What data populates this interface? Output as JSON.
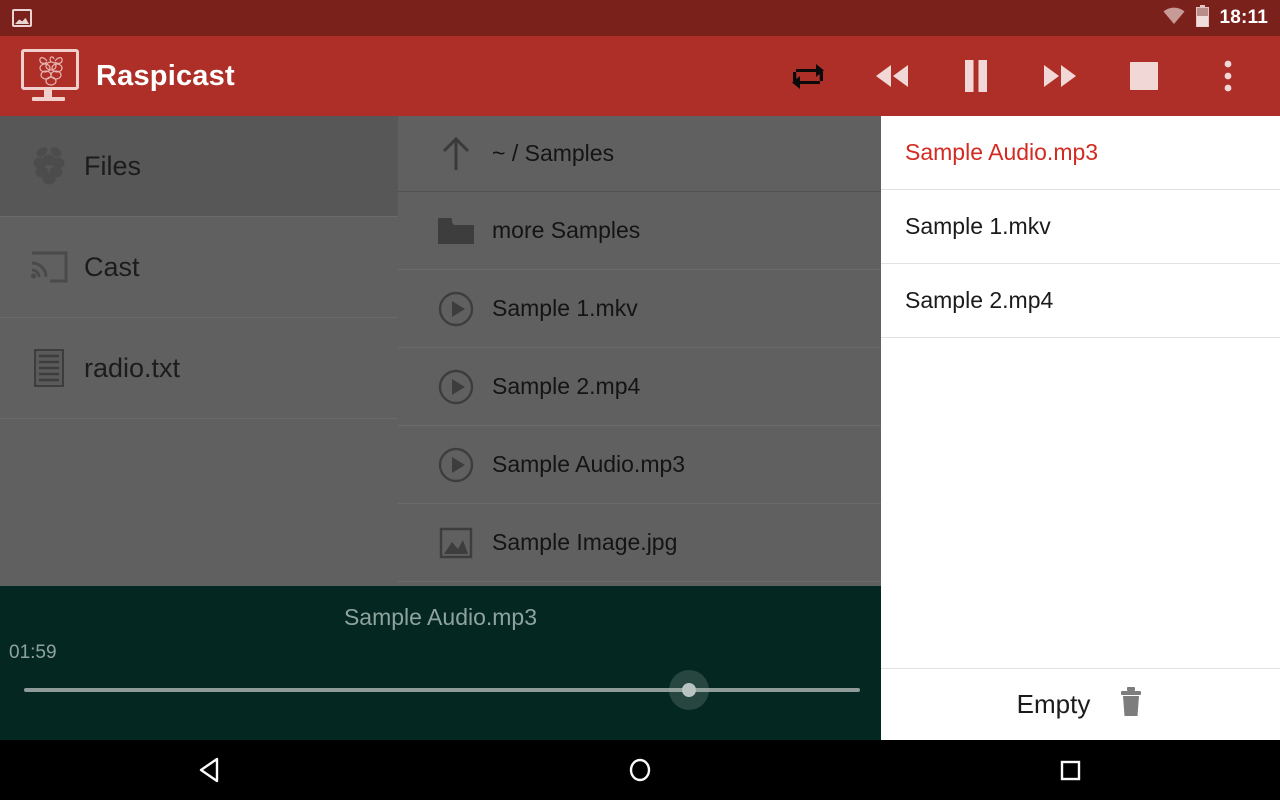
{
  "statusbar": {
    "notification_icon": "image-notification-icon",
    "wifi_icon": "wifi-icon",
    "battery_icon": "battery-icon",
    "clock": "18:11",
    "bg_color": "#7a211c"
  },
  "appbar": {
    "logo_icon": "raspberry-pi-monitor-logo",
    "title": "Raspicast",
    "bg_color": "#ad2f28",
    "actions": [
      {
        "name": "repeat-button",
        "icon": "repeat-icon",
        "active": true
      },
      {
        "name": "rewind-button",
        "icon": "fast-rewind-icon",
        "active": false
      },
      {
        "name": "pause-button",
        "icon": "pause-icon",
        "active": false
      },
      {
        "name": "forward-button",
        "icon": "fast-forward-icon",
        "active": false
      },
      {
        "name": "stop-button",
        "icon": "stop-icon",
        "active": false
      },
      {
        "name": "overflow-menu-button",
        "icon": "more-vertical-icon",
        "active": false
      }
    ]
  },
  "drawer": {
    "items": [
      {
        "label": "Files",
        "icon": "raspberry-pi-icon",
        "selected": true
      },
      {
        "label": "Cast",
        "icon": "cast-icon",
        "selected": false
      },
      {
        "label": "radio.txt",
        "icon": "text-file-icon",
        "selected": false
      }
    ]
  },
  "filelist": {
    "header": {
      "label": "~ / Samples",
      "icon": "arrow-up-icon"
    },
    "rows": [
      {
        "label": "more Samples",
        "icon": "folder-icon"
      },
      {
        "label": "Sample 1.mkv",
        "icon": "play-circle-icon"
      },
      {
        "label": "Sample 2.mp4",
        "icon": "play-circle-icon"
      },
      {
        "label": "Sample Audio.mp3",
        "icon": "play-circle-icon"
      },
      {
        "label": "Sample Image.jpg",
        "icon": "image-icon"
      }
    ]
  },
  "playlist": {
    "items": [
      {
        "label": "Sample Audio.mp3",
        "active": true
      },
      {
        "label": "Sample 1.mkv",
        "active": false
      },
      {
        "label": "Sample 2.mp4",
        "active": false
      }
    ],
    "active_color": "#d32a22",
    "footer": {
      "label": "Empty",
      "icon": "trash-icon"
    }
  },
  "player": {
    "title": "Sample Audio.mp3",
    "time": "01:59",
    "progress_percent": 79,
    "bg_color": "#042721"
  },
  "navbar": {
    "back": "back-triangle-icon",
    "home": "home-circle-icon",
    "recents": "recents-square-icon"
  }
}
